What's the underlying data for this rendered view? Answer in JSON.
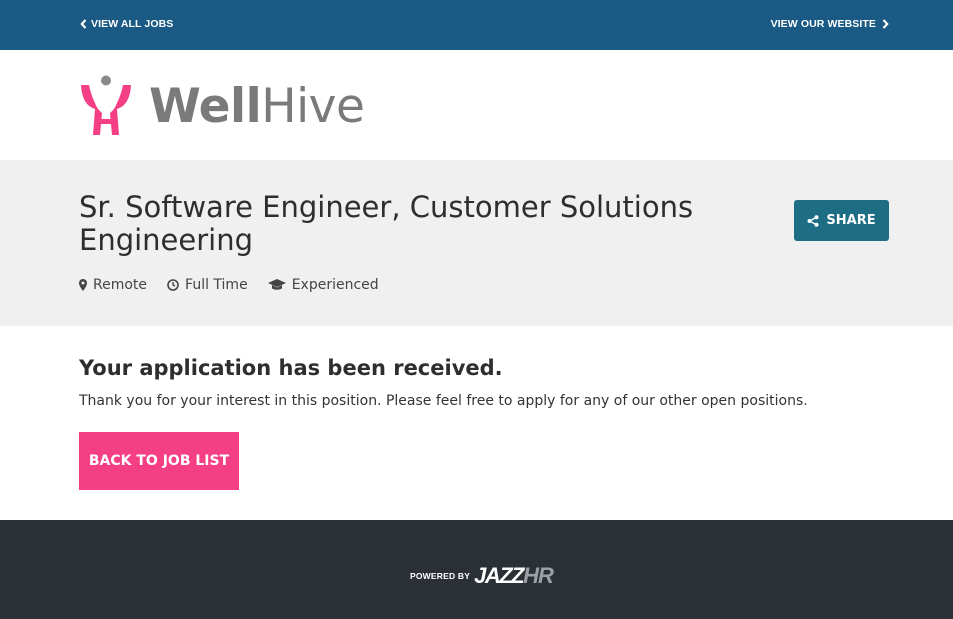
{
  "topbar": {
    "view_all_jobs": "VIEW ALL JOBS",
    "view_website": "VIEW OUR WEBSITE"
  },
  "logo": {
    "well": "Well",
    "hive": "Hive",
    "icon": "wellhive-logo-icon"
  },
  "job": {
    "title": "Sr. Software Engineer, Customer Solutions Engineering",
    "share_label": "SHARE",
    "meta": {
      "location": "Remote",
      "type": "Full Time",
      "level": "Experienced"
    }
  },
  "confirmation": {
    "heading": "Your application has been received.",
    "message": "Thank you for your interest in this position. Please feel free to apply for any of our other open positions.",
    "back_button": "BACK TO JOB LIST"
  },
  "footer": {
    "powered_by": "POWERED BY",
    "brand_jazz": "JAZZ",
    "brand_hr": "HR"
  },
  "colors": {
    "topbar": "#1a5a84",
    "share": "#1d6d85",
    "accent": "#f43f84",
    "band": "#eff0ef",
    "footer": "#2b3037"
  }
}
